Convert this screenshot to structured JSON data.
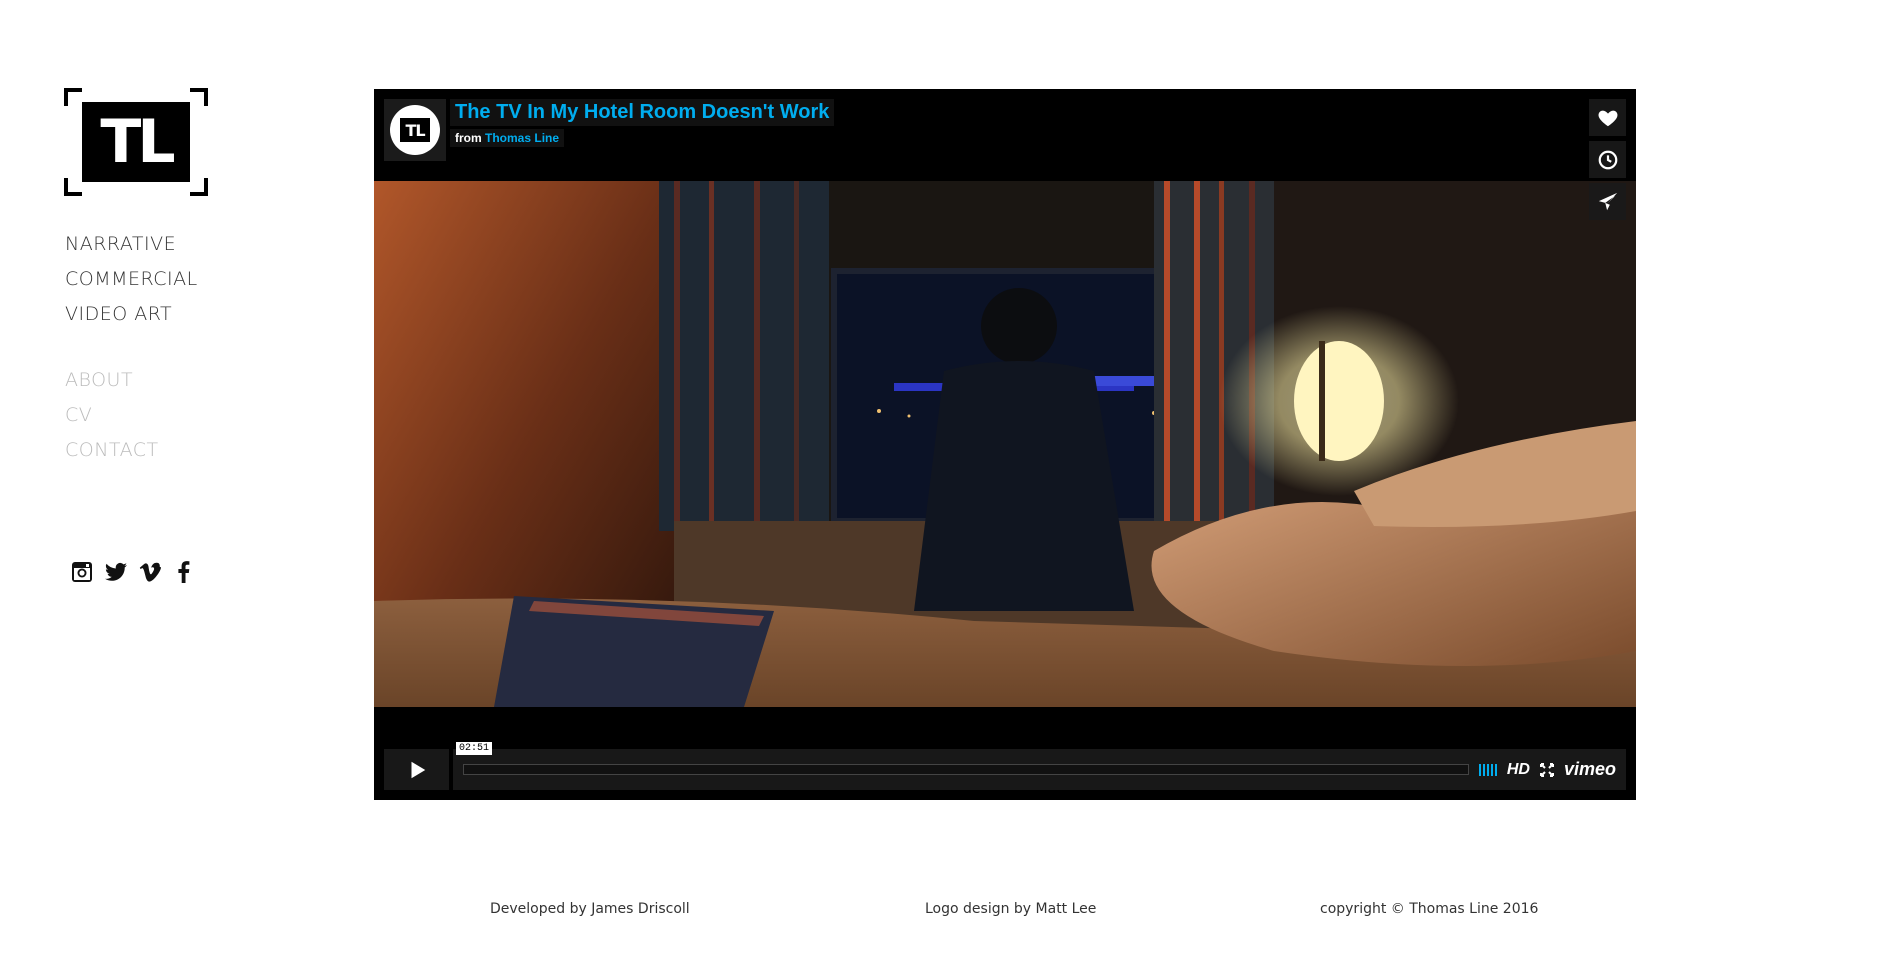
{
  "logo": {
    "text": "TL"
  },
  "nav_primary": [
    "NARRATIVE",
    "COMMERCIAL",
    "VIDEO ART"
  ],
  "nav_secondary": [
    "ABOUT",
    "CV",
    "CONTACT"
  ],
  "social_icons": [
    "instagram-icon",
    "twitter-icon",
    "vimeo-icon",
    "facebook-icon"
  ],
  "player": {
    "title": "The TV In My Hotel Room Doesn't Work",
    "from_label": "from",
    "author": "Thomas Line",
    "portrait_text": "TL",
    "side_buttons": [
      "like-icon",
      "watch-later-icon",
      "share-icon"
    ],
    "time_tooltip": "02:51",
    "hd_label": "HD",
    "vimeo_label": "vimeo",
    "accent_color": "#00adef"
  },
  "footer": {
    "developer": "Developed by James Driscoll",
    "logo_credit": "Logo design by Matt Lee",
    "copyright": "copyright © Thomas Line 2016"
  }
}
